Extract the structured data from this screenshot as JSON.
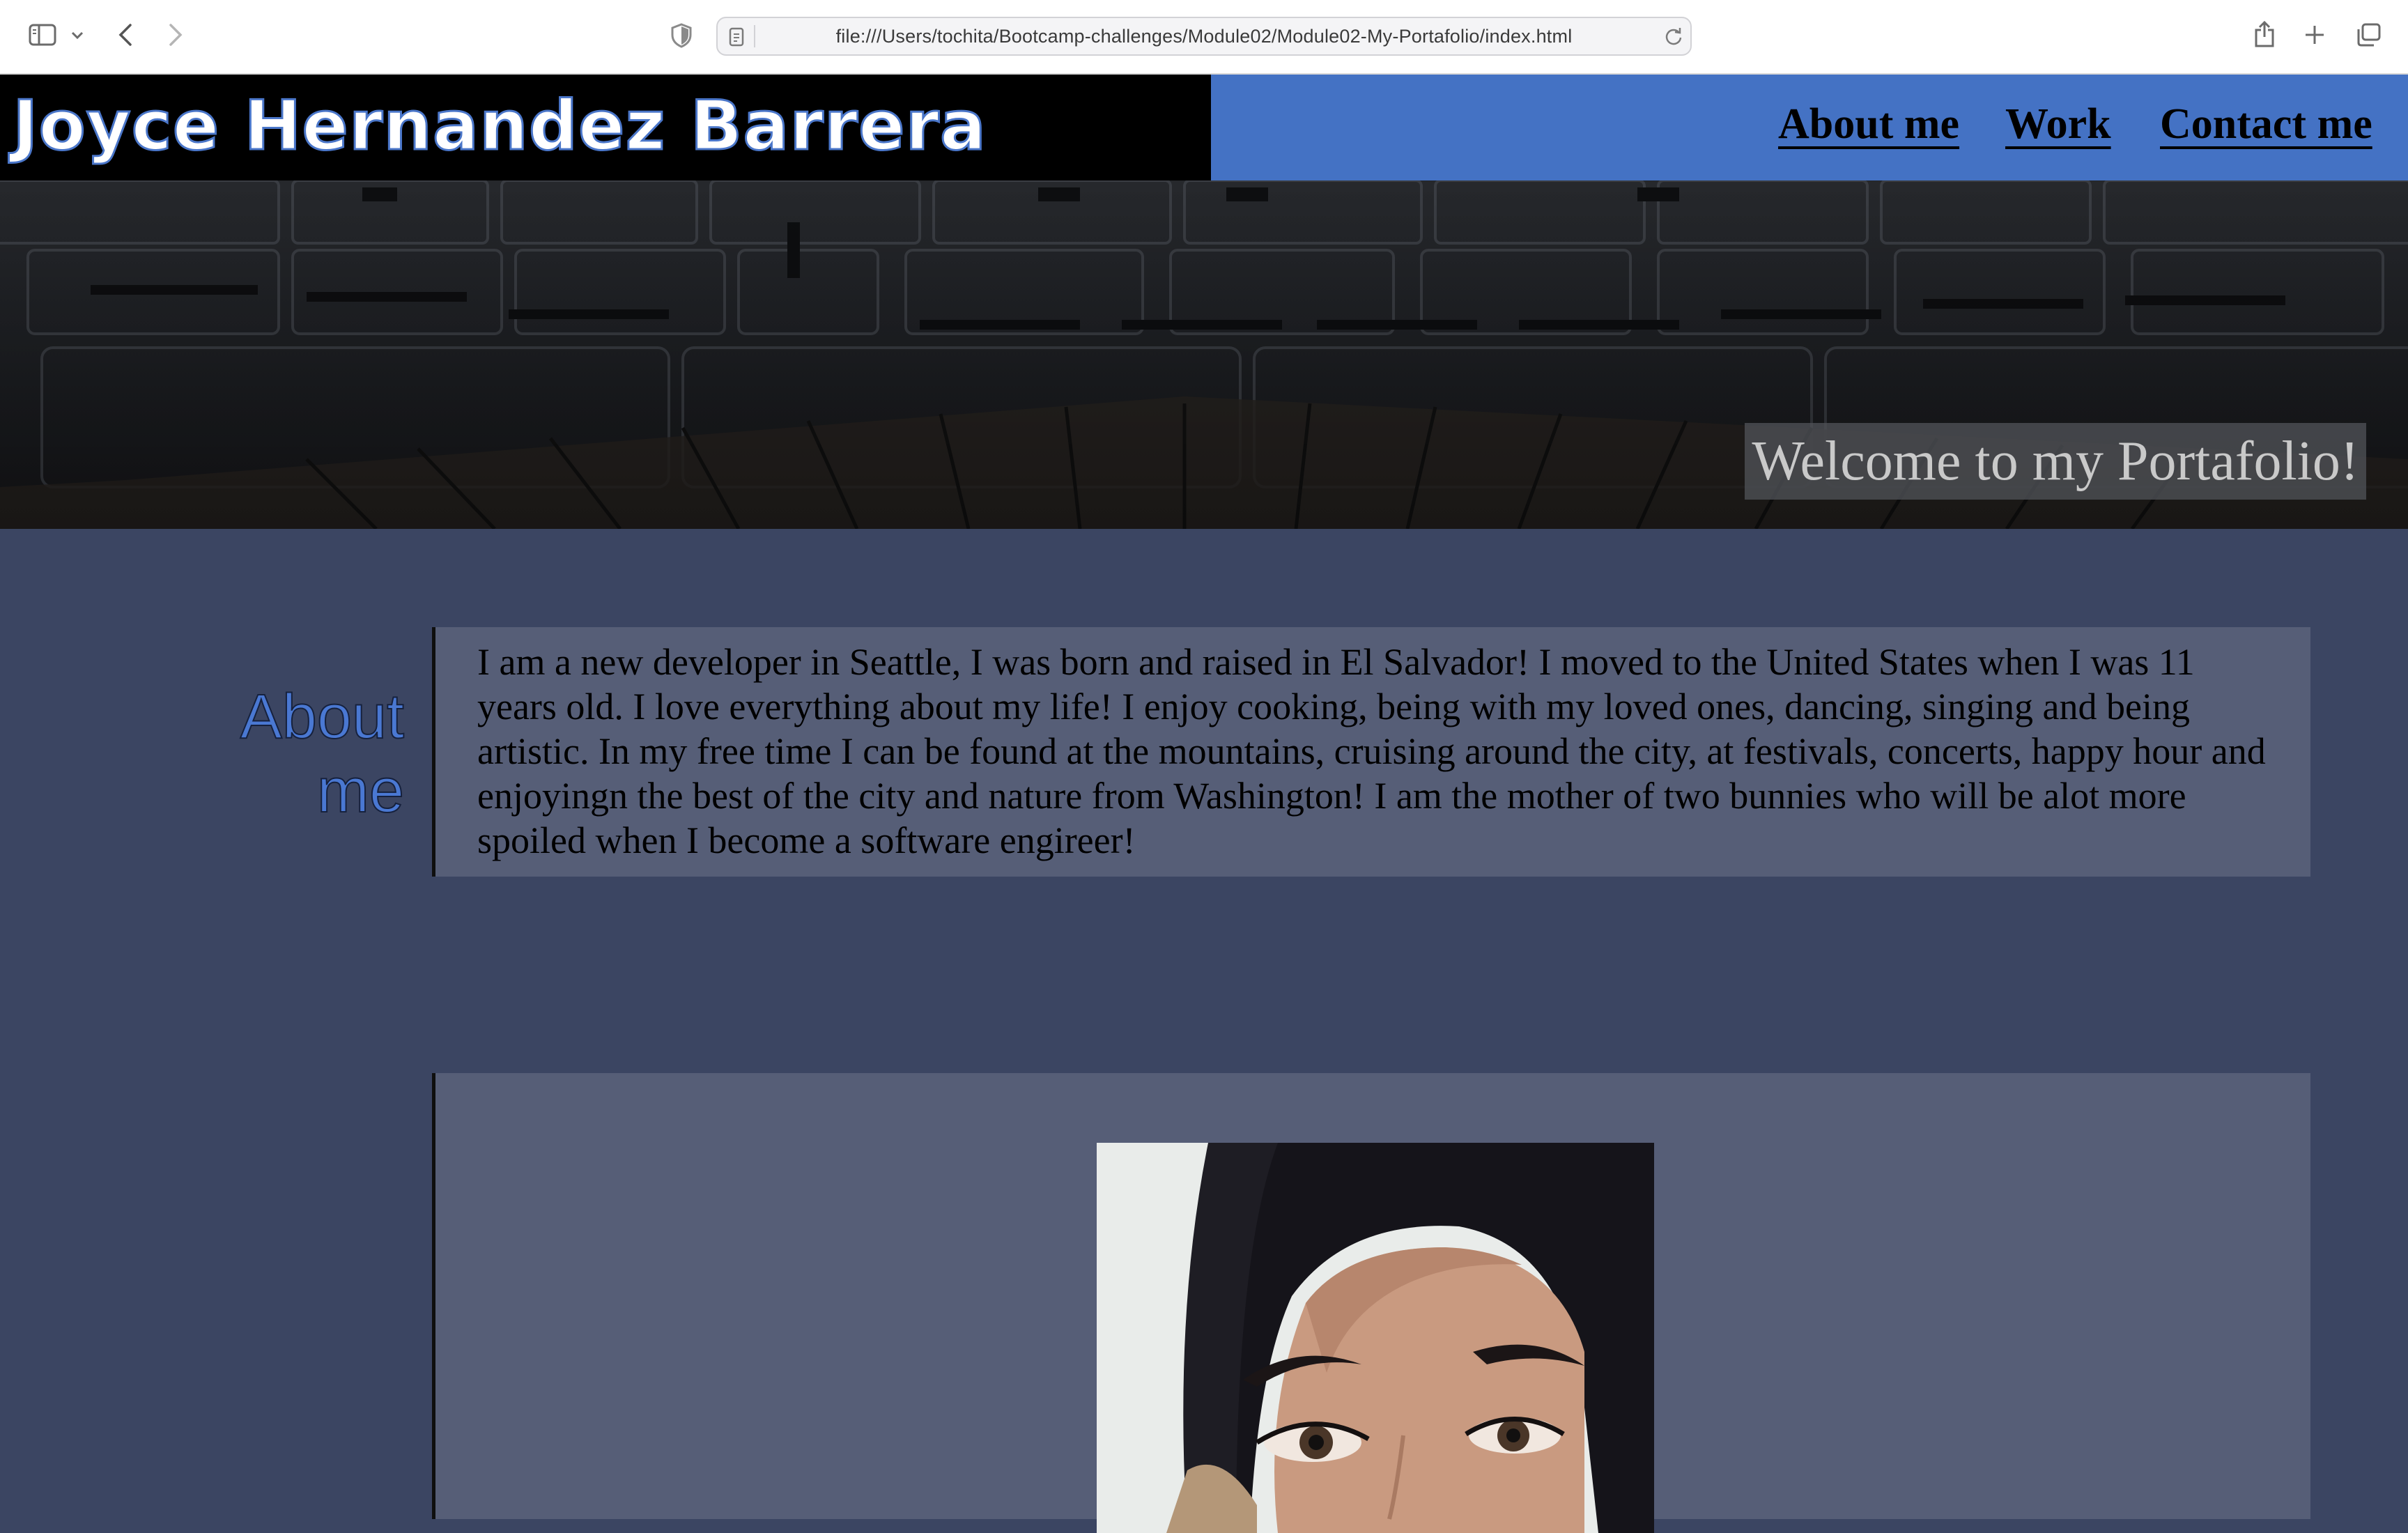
{
  "browser": {
    "url": "file:///Users/tochita/Bootcamp-challenges/Module02/Module02-My-Portafolio/index.html"
  },
  "header": {
    "title": "Joyce Hernandez Barrera",
    "nav": [
      "About me",
      "Work",
      "Contact me"
    ]
  },
  "hero": {
    "welcome": "Welcome to my Portafolio!"
  },
  "about": {
    "heading": "About me",
    "text": "I am a new developer in Seattle, I was born and raised in El Salvador! I moved to the United States when I was 11 years old. I love everything about my life! I enjoy cooking, being with my loved ones, dancing, singing and being artistic. In my free time I can be found at the mountains, cruising around the city, at festivals, concerts, happy hour and enjoyingn the best of the city and nature from Washington! I am the mother of two bunnies who will be alot more spoiled when I become a software engireer!"
  },
  "colors": {
    "header_nav_bg": "#4472c4",
    "brand_bg": "#000000",
    "page_bg": "#3b4562",
    "card_bg": "#565e77",
    "about_heading": "#4a78d2"
  },
  "icons": [
    "sidebar-icon",
    "chevron-down-icon",
    "back-icon",
    "forward-icon",
    "shield-icon",
    "page-icon",
    "reload-icon",
    "share-icon",
    "plus-icon",
    "tabs-icon"
  ]
}
